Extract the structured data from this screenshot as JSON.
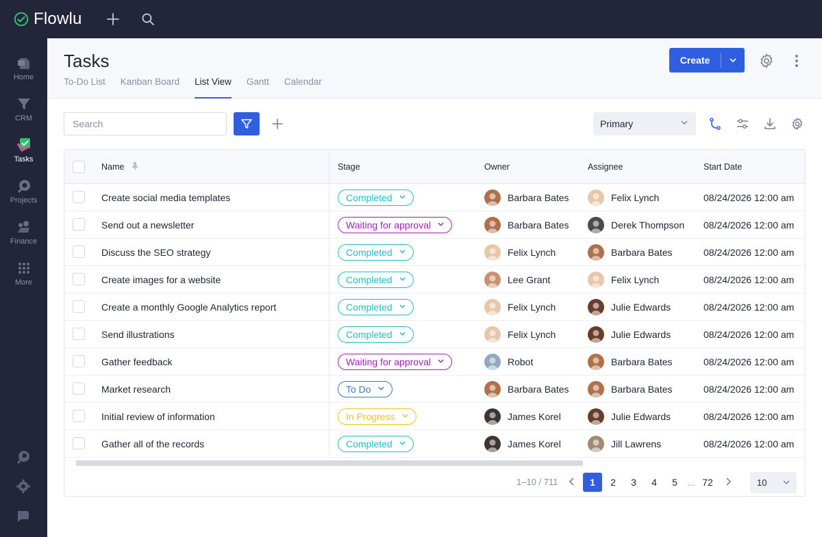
{
  "app": {
    "name": "Flowlu"
  },
  "sidebar": {
    "items": [
      {
        "label": "Home",
        "icon": "home-icon"
      },
      {
        "label": "CRM",
        "icon": "crm-icon"
      },
      {
        "label": "Tasks",
        "icon": "tasks-icon",
        "active": true
      },
      {
        "label": "Projects",
        "icon": "projects-icon"
      },
      {
        "label": "Finance",
        "icon": "finance-icon"
      },
      {
        "label": "More",
        "icon": "more-grid-icon"
      }
    ],
    "bottom_icons": [
      "knowledge-base-icon",
      "settings-icon",
      "chat-icon"
    ]
  },
  "header": {
    "title": "Tasks",
    "tabs": [
      "To-Do List",
      "Kanban Board",
      "List View",
      "Gantt",
      "Calendar"
    ],
    "active_tab": "List View",
    "create_label": "Create"
  },
  "toolbar": {
    "search_placeholder": "Search",
    "view_select_value": "Primary"
  },
  "table": {
    "columns": [
      "Name",
      "Stage",
      "Owner",
      "Assignee",
      "Start Date"
    ],
    "rows": [
      {
        "name": "Create social media templates",
        "stage": "Completed",
        "owner": "Barbara Bates",
        "assignee": "Felix Lynch",
        "start": "08/24/2026 12:00 am"
      },
      {
        "name": "Send out a newsletter",
        "stage": "Waiting for approval",
        "owner": "Barbara Bates",
        "assignee": "Derek Thompson",
        "start": "08/24/2026 12:00 am"
      },
      {
        "name": "Discuss the SEO strategy",
        "stage": "Completed",
        "owner": "Felix Lynch",
        "assignee": "Barbara Bates",
        "start": "08/24/2026 12:00 am"
      },
      {
        "name": "Create images for a website",
        "stage": "Completed",
        "owner": "Lee Grant",
        "assignee": "Felix Lynch",
        "start": "08/24/2026 12:00 am"
      },
      {
        "name": "Create a monthly Google Analytics report",
        "stage": "Completed",
        "owner": "Felix Lynch",
        "assignee": "Julie Edwards",
        "start": "08/24/2026 12:00 am"
      },
      {
        "name": "Send illustrations",
        "stage": "Completed",
        "owner": "Felix Lynch",
        "assignee": "Julie Edwards",
        "start": "08/24/2026 12:00 am"
      },
      {
        "name": "Gather feedback",
        "stage": "Waiting for approval",
        "owner": "Robot",
        "assignee": "Barbara Bates",
        "start": "08/24/2026 12:00 am"
      },
      {
        "name": "Market research",
        "stage": "To Do",
        "owner": "Barbara Bates",
        "assignee": "Barbara Bates",
        "start": "08/24/2026 12:00 am"
      },
      {
        "name": "Initial review of information",
        "stage": "In Progress",
        "owner": "James Korel",
        "assignee": "Julie Edwards",
        "start": "08/24/2026 12:00 am"
      },
      {
        "name": "Gather all of the records",
        "stage": "Completed",
        "owner": "James Korel",
        "assignee": "Jill Lawrens",
        "start": "08/24/2026 12:00 am"
      }
    ]
  },
  "stage_colors": {
    "Completed": "#1fbfc9",
    "Waiting for approval": "#a020b8",
    "To Do": "#3d78b8",
    "In Progress": "#f2c01c"
  },
  "people_colors": {
    "Barbara Bates": "#b0704a",
    "Felix Lynch": "#e8c6a8",
    "Derek Thompson": "#4a4a4e",
    "Lee Grant": "#c79272",
    "Julie Edwards": "#6a3c2c",
    "Robot": "#93a9bf",
    "James Korel": "#3e3430",
    "Jill Lawrens": "#a08a74"
  },
  "pagination": {
    "range": "1–10 / 711",
    "pages": [
      "1",
      "2",
      "3",
      "4",
      "5"
    ],
    "ellipsis": "...",
    "last": "72",
    "current": "1",
    "page_size": "10"
  },
  "colors": {
    "accent": "#2f5fe0",
    "sidebar": "#23253b",
    "logo": "#2cc16a"
  }
}
